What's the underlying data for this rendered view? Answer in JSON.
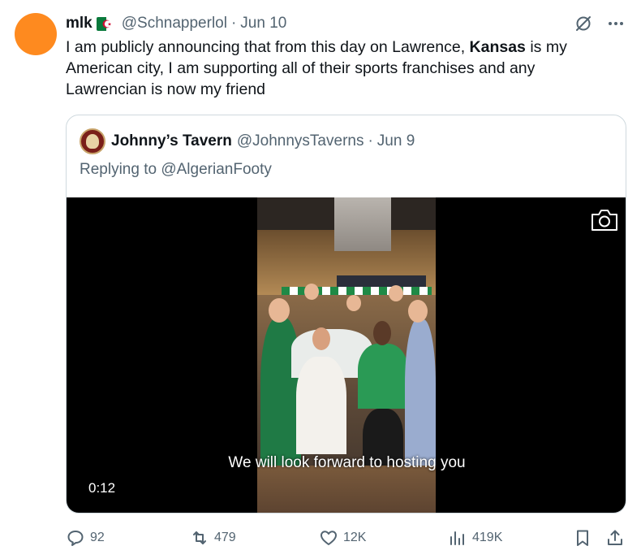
{
  "author": {
    "name": "mlk",
    "flag": "algeria-flag",
    "handle": "@Schnapperlol",
    "separator": "·",
    "date": "Jun 10",
    "avatar_color": "#fe8a1f"
  },
  "tweet": {
    "text_before": "I am publicly announcing that from this day on Lawrence, ",
    "text_bold": "Kansas",
    "text_after": " is my American city, I am supporting all of their sports franchises and any Lawrencian is now my friend"
  },
  "quote": {
    "name": "Johnny’s Tavern",
    "handle": "@JohnnysTaverns",
    "separator": "·",
    "date": "Jun 9",
    "reply_prefix": "Replying to ",
    "reply_handle": "@AlgerianFooty",
    "video": {
      "caption": "We will look forward to hosting you",
      "duration": "0:12"
    }
  },
  "actions": {
    "replies": "92",
    "retweets": "479",
    "likes": "12K",
    "views": "419K"
  },
  "colors": {
    "muted": "#536471",
    "border": "#cfd9de",
    "text": "#0f1419"
  }
}
